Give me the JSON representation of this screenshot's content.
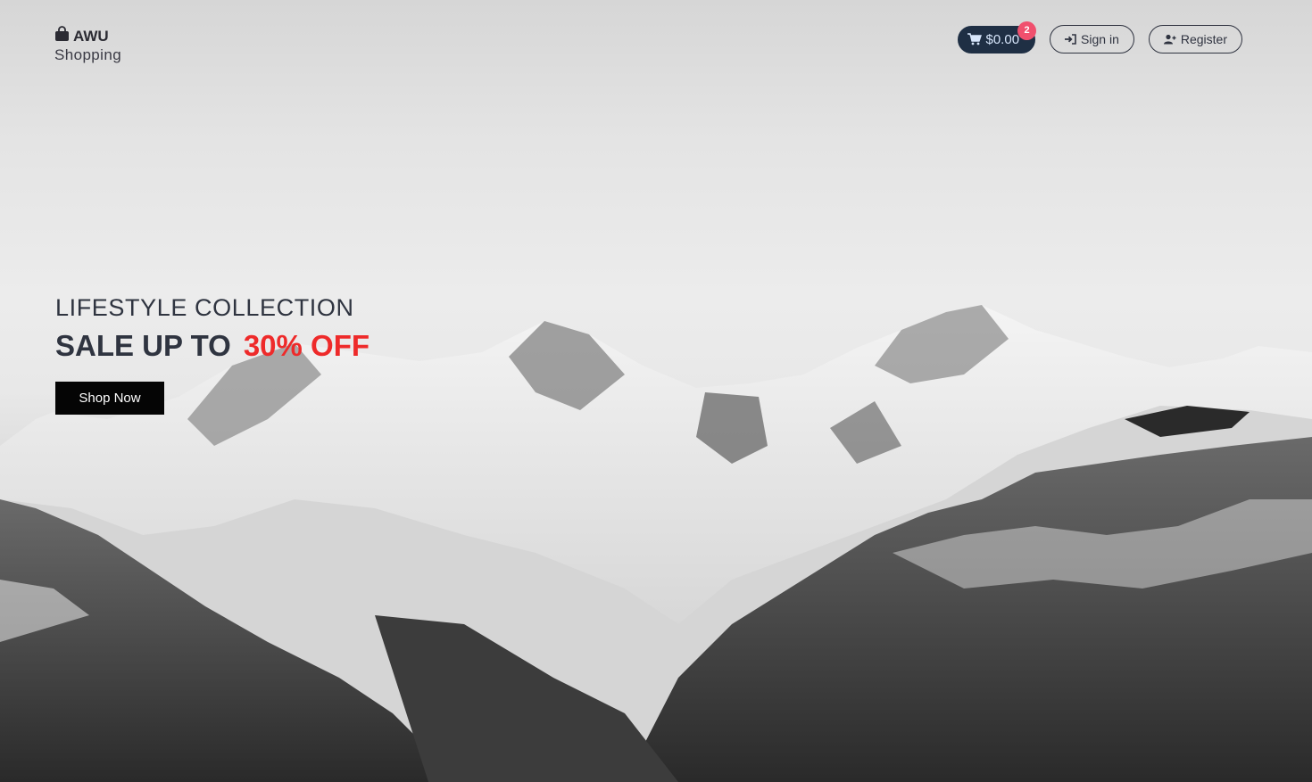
{
  "brand": {
    "name": "AWU",
    "tagline": "Shopping",
    "icon": "shopping-bag-icon"
  },
  "nav": {
    "cart": {
      "label": "$0.00",
      "count": "2",
      "icon": "cart-icon"
    },
    "sign_in": {
      "label": "Sign in",
      "icon": "sign-in-icon"
    },
    "register": {
      "label": "Register",
      "icon": "user-plus-icon"
    }
  },
  "hero": {
    "kicker": "LIFESTYLE COLLECTION",
    "headline_prefix": "SALE UP TO",
    "headline_accent": "30% OFF",
    "cta_label": "Shop Now",
    "background": "snowy-mountains-photo"
  },
  "colors": {
    "accent": "#ee2a2a",
    "cart_bg": "#1f2f44",
    "badge": "#f0506e",
    "cta_bg": "#050505"
  }
}
